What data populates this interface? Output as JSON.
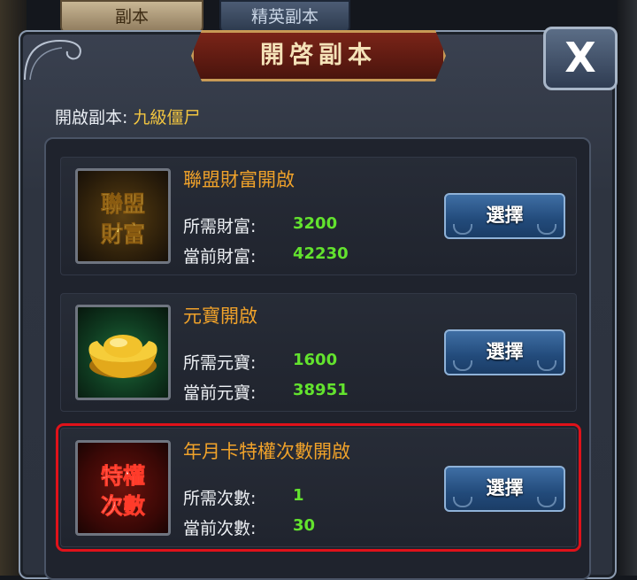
{
  "top_tabs": [
    {
      "label": "副本"
    },
    {
      "label": "精英副本"
    }
  ],
  "dialog": {
    "title": "開啓副本",
    "close_label": "X",
    "open_instance_label": "開啟副本:",
    "open_instance_value": "九級僵尸"
  },
  "options": [
    {
      "title": "聯盟財富開啟",
      "icon_text": [
        "聯盟",
        "財富"
      ],
      "required_label": "所需財富:",
      "required_value": "3200",
      "current_label": "當前財富:",
      "current_value": "42230",
      "button_label": "選擇"
    },
    {
      "title": "元寶開啟",
      "icon": "gold-ingot-icon",
      "required_label": "所需元寶:",
      "required_value": "1600",
      "current_label": "當前元寶:",
      "current_value": "38951",
      "button_label": "選擇"
    },
    {
      "title": "年月卡特權次數開啟",
      "icon_text": [
        "特權",
        "次數"
      ],
      "required_label": "所需次數:",
      "required_value": "1",
      "current_label": "當前次數:",
      "current_value": "30",
      "button_label": "選擇",
      "highlighted": true
    }
  ],
  "colors": {
    "title_orange": "#f0a22a",
    "value_green": "#63e32e",
    "highlight_red": "#e0121a",
    "instance_yellow": "#f3c640"
  }
}
